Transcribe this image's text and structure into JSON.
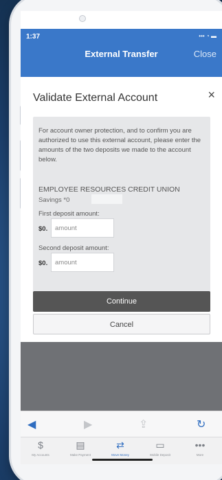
{
  "status": {
    "time": "1:37",
    "signal": "•••",
    "wifi": "◔",
    "battery": "▬"
  },
  "header": {
    "title": "External Transfer",
    "close": "Close"
  },
  "modal": {
    "title": "Validate External Account",
    "close_icon": "×",
    "description": "For account owner protection, and to confirm you are authorized to use this external account, please enter the amounts of the two deposits we made to the account below.",
    "institution": "EMPLOYEE RESOURCES CREDIT UNION",
    "account": "Savings *0",
    "first_label": "First deposit amount:",
    "second_label": "Second deposit amount:",
    "currency_prefix": "$0.",
    "first_placeholder": "amount",
    "second_placeholder": "amount",
    "continue": "Continue",
    "cancel": "Cancel"
  },
  "toolbar": {
    "back": "◀",
    "forward": "▶",
    "share": "⇪",
    "refresh": "↻"
  },
  "tabs": [
    {
      "label": "My Accounts",
      "icon": "$"
    },
    {
      "label": "Make Payment",
      "icon": "▤"
    },
    {
      "label": "Move Money",
      "icon": "⇄"
    },
    {
      "label": "Mobile Deposit",
      "icon": "▭"
    },
    {
      "label": "More",
      "icon": "•••"
    }
  ],
  "colors": {
    "header": "#3a78c9",
    "active_tab": "#2f6dc0"
  }
}
